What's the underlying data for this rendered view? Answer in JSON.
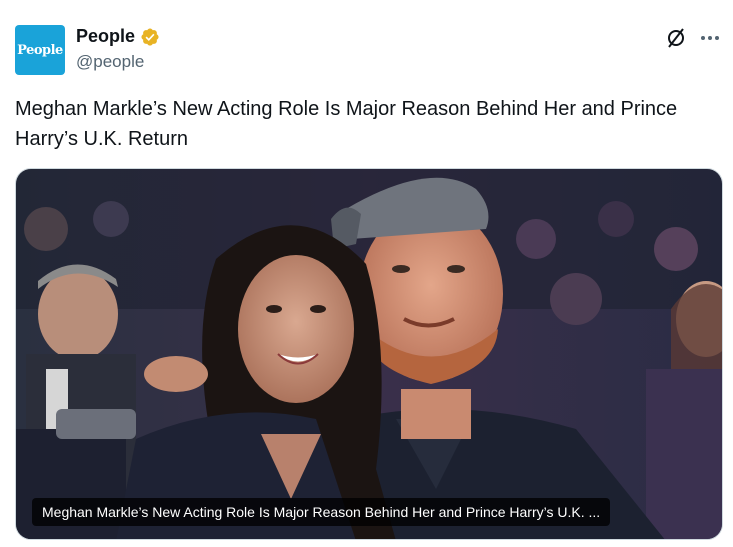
{
  "account": {
    "avatar_text": "People",
    "display_name": "People",
    "handle": "@people",
    "verified_badge_color": "#e8b324",
    "avatar_color": "#1aa3d9"
  },
  "actions": {
    "grok_icon": "grok-icon",
    "more_icon": "more-icon"
  },
  "tweet": {
    "text": "Meghan Markle’s New Acting Role Is Major Reason Behind Her and Prince Harry’s U.K. Return"
  },
  "media": {
    "type": "link-card-image",
    "caption": "Meghan Markle’s New Acting Role Is Major Reason Behind Her and Prince Harry’s U.K. ..."
  }
}
